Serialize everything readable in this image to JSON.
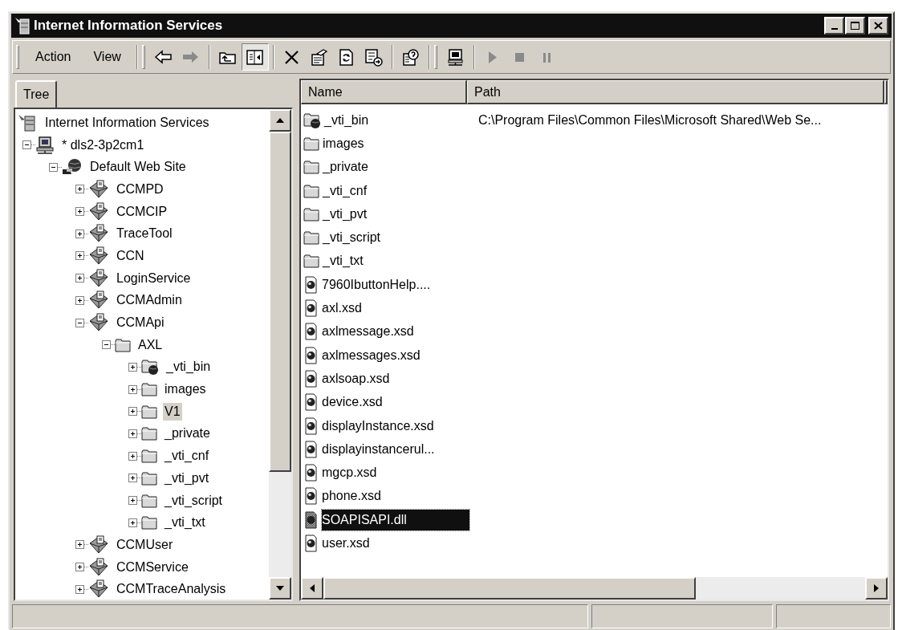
{
  "window": {
    "title": "Internet Information Services"
  },
  "toolbar": [
    {
      "kind": "band",
      "items": [
        {
          "kind": "menu",
          "label": "Action"
        },
        {
          "kind": "menu",
          "label": "View"
        }
      ]
    },
    {
      "kind": "band",
      "items": [
        {
          "kind": "back",
          "disabled": false,
          "pressed": false
        },
        {
          "kind": "forward",
          "disabled": true,
          "pressed": false
        }
      ]
    },
    {
      "kind": "group",
      "items": [
        {
          "kind": "up",
          "disabled": false,
          "pressed": false
        },
        {
          "kind": "tree",
          "disabled": false,
          "pressed": true
        }
      ]
    },
    {
      "kind": "group",
      "items": [
        {
          "kind": "delete",
          "disabled": false,
          "pressed": false
        },
        {
          "kind": "properties",
          "disabled": false,
          "pressed": false
        },
        {
          "kind": "refresh",
          "disabled": false,
          "pressed": false
        },
        {
          "kind": "export",
          "disabled": false,
          "pressed": false
        }
      ]
    },
    {
      "kind": "group",
      "items": [
        {
          "kind": "help",
          "disabled": false,
          "pressed": false
        }
      ]
    },
    {
      "kind": "band",
      "items": [
        {
          "kind": "computer",
          "disabled": false,
          "pressed": false
        }
      ]
    },
    {
      "kind": "group",
      "items": [
        {
          "kind": "play",
          "disabled": true,
          "pressed": false
        },
        {
          "kind": "stop",
          "disabled": true,
          "pressed": false
        },
        {
          "kind": "pause",
          "disabled": true,
          "pressed": false
        }
      ]
    }
  ],
  "tabs": [
    {
      "label": "Tree",
      "selected": true
    }
  ],
  "tree": [
    {
      "label": "Internet Information Services",
      "kind": "iis",
      "selected": false,
      "children": [
        {
          "label": "* dls2-3p2cm1",
          "kind": "computer",
          "expanded": true,
          "selected": false,
          "children": [
            {
              "label": "Default Web Site",
              "kind": "website",
              "expanded": true,
              "selected": false,
              "children": [
                {
                  "label": "CCMPD",
                  "kind": "app",
                  "expanded": false,
                  "selected": false
                },
                {
                  "label": "CCMCIP",
                  "kind": "app",
                  "expanded": false,
                  "selected": false
                },
                {
                  "label": "TraceTool",
                  "kind": "app",
                  "expanded": false,
                  "selected": false
                },
                {
                  "label": "CCN",
                  "kind": "app",
                  "expanded": false,
                  "selected": false
                },
                {
                  "label": "LoginService",
                  "kind": "app",
                  "expanded": false,
                  "selected": false
                },
                {
                  "label": "CCMAdmin",
                  "kind": "app",
                  "expanded": false,
                  "selected": false
                },
                {
                  "label": "CCMApi",
                  "kind": "app",
                  "expanded": true,
                  "selected": false,
                  "children": [
                    {
                      "label": "AXL",
                      "kind": "folder",
                      "expanded": true,
                      "selected": false,
                      "children": [
                        {
                          "label": "_vti_bin",
                          "kind": "web-folder",
                          "expanded": false,
                          "selected": false
                        },
                        {
                          "label": "images",
                          "kind": "folder",
                          "expanded": false,
                          "selected": false
                        },
                        {
                          "label": "V1",
                          "kind": "folder",
                          "expanded": false,
                          "selected": true
                        },
                        {
                          "label": "_private",
                          "kind": "folder",
                          "expanded": false,
                          "selected": false
                        },
                        {
                          "label": "_vti_cnf",
                          "kind": "folder",
                          "expanded": false,
                          "selected": false
                        },
                        {
                          "label": "_vti_pvt",
                          "kind": "folder",
                          "expanded": false,
                          "selected": false
                        },
                        {
                          "label": "_vti_script",
                          "kind": "folder",
                          "expanded": false,
                          "selected": false
                        },
                        {
                          "label": "_vti_txt",
                          "kind": "folder",
                          "expanded": false,
                          "selected": false
                        }
                      ]
                    }
                  ]
                },
                {
                  "label": "CCMUser",
                  "kind": "app",
                  "expanded": false,
                  "selected": false
                },
                {
                  "label": "CCMService",
                  "kind": "app",
                  "expanded": false,
                  "selected": false
                },
                {
                  "label": "CCMTraceAnalysis",
                  "kind": "app",
                  "expanded": false,
                  "selected": false
                }
              ]
            }
          ]
        }
      ]
    }
  ],
  "table": {
    "columns": [
      "Name",
      "Path"
    ],
    "rows": [
      {
        "name": "_vti_bin",
        "path": "C:\\Program Files\\Common Files\\Microsoft Shared\\Web Se...",
        "kind": "web-folder",
        "selected": false
      },
      {
        "name": "images",
        "kind": "folder",
        "selected": false
      },
      {
        "name": "_private",
        "kind": "folder",
        "selected": false
      },
      {
        "name": "_vti_cnf",
        "kind": "folder",
        "selected": false
      },
      {
        "name": "_vti_pvt",
        "kind": "folder",
        "selected": false
      },
      {
        "name": "_vti_script",
        "kind": "folder",
        "selected": false
      },
      {
        "name": "_vti_txt",
        "kind": "folder",
        "selected": false
      },
      {
        "name": "7960IbuttonHelp....",
        "kind": "file",
        "selected": false
      },
      {
        "name": "axl.xsd",
        "kind": "file",
        "selected": false
      },
      {
        "name": "axlmessage.xsd",
        "kind": "file",
        "selected": false
      },
      {
        "name": "axlmessages.xsd",
        "kind": "file",
        "selected": false
      },
      {
        "name": "axlsoap.xsd",
        "kind": "file",
        "selected": false
      },
      {
        "name": "device.xsd",
        "kind": "file",
        "selected": false
      },
      {
        "name": "displayInstance.xsd",
        "kind": "file",
        "selected": false
      },
      {
        "name": "displayinstancerul...",
        "kind": "file",
        "selected": false
      },
      {
        "name": "mgcp.xsd",
        "kind": "file",
        "selected": false
      },
      {
        "name": "phone.xsd",
        "kind": "file",
        "selected": false
      },
      {
        "name": "SOAPISAPI.dll",
        "kind": "dll",
        "selected": true
      },
      {
        "name": "user.xsd",
        "kind": "file",
        "selected": false
      }
    ]
  }
}
